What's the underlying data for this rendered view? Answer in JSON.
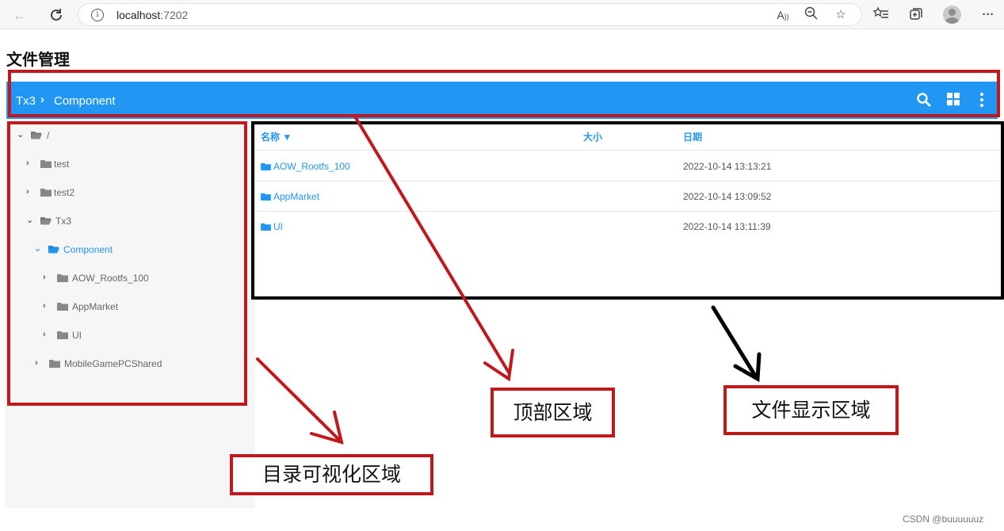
{
  "browser": {
    "url_host": "localhost",
    "url_port": ":7202",
    "read_aloud_label": "A",
    "menu_label": "···"
  },
  "page_title": "文件管理",
  "topbar": {
    "crumbs": [
      "Tx3",
      "Component"
    ],
    "color": "#2196f3"
  },
  "tree": {
    "root": "/",
    "items": [
      {
        "label": "test"
      },
      {
        "label": "test2"
      },
      {
        "label": "Tx3"
      },
      {
        "label": "Component"
      },
      {
        "label": "AOW_Rootfs_100"
      },
      {
        "label": "AppMarket"
      },
      {
        "label": "UI"
      },
      {
        "label": "MobileGamePCShared"
      }
    ]
  },
  "file_table": {
    "headers": {
      "name": "名称 ▼",
      "size": "大小",
      "date": "日期"
    },
    "rows": [
      {
        "name": "AOW_Rootfs_100",
        "size": "",
        "date": "2022-10-14 13:13:21"
      },
      {
        "name": "AppMarket",
        "size": "",
        "date": "2022-10-14 13:09:52"
      },
      {
        "name": "UI",
        "size": "",
        "date": "2022-10-14 13:11:39"
      }
    ]
  },
  "annotations": {
    "top_area": "顶部区域",
    "file_area": "文件显示区域",
    "dir_area": "目录可视化区域",
    "color_red": "#c0181d",
    "color_black": "#000000"
  },
  "watermark": "CSDN @buuuuuuz"
}
